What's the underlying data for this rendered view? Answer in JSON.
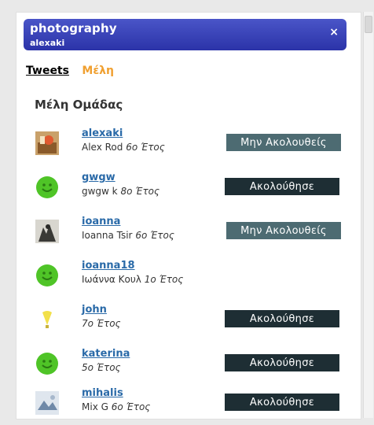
{
  "group": {
    "title": "photography",
    "owner": "alexaki",
    "close_label": "×"
  },
  "tabs": {
    "tweets": "Tweets",
    "members": "Μέλη"
  },
  "section_title": "Μέλη Ομάδας",
  "members": [
    {
      "username": "alexaki",
      "fullname": "Alex Rod",
      "year": "6ο Έτος",
      "button": "Μην Ακολουθείς",
      "avatar": "photo-avatar-icon"
    },
    {
      "username": "gwgw",
      "fullname": "gwgw k",
      "year": "8ο Έτος",
      "button": "Ακολούθησε",
      "avatar": "smiley-avatar-icon"
    },
    {
      "username": "ioanna",
      "fullname": "Ioanna Tsir",
      "year": "6ο Έτος",
      "button": "Μην Ακολουθείς",
      "avatar": "photo-avatar-icon"
    },
    {
      "username": "ioanna18",
      "fullname": "Ιωάννα Κουλ",
      "year": "1ο Έτος",
      "button": "",
      "avatar": "smiley-avatar-icon"
    },
    {
      "username": "john",
      "fullname": "",
      "year": "7ο Έτος",
      "button": "Ακολούθησε",
      "avatar": "lightbulb-avatar-icon"
    },
    {
      "username": "katerina",
      "fullname": "",
      "year": "5ο Έτος",
      "button": "Ακολούθησε",
      "avatar": "smiley-avatar-icon"
    },
    {
      "username": "mihalis",
      "fullname": "Mix G",
      "year": "6ο Έτος",
      "button": "Ακολούθησε",
      "avatar": "photo-avatar-icon"
    }
  ]
}
